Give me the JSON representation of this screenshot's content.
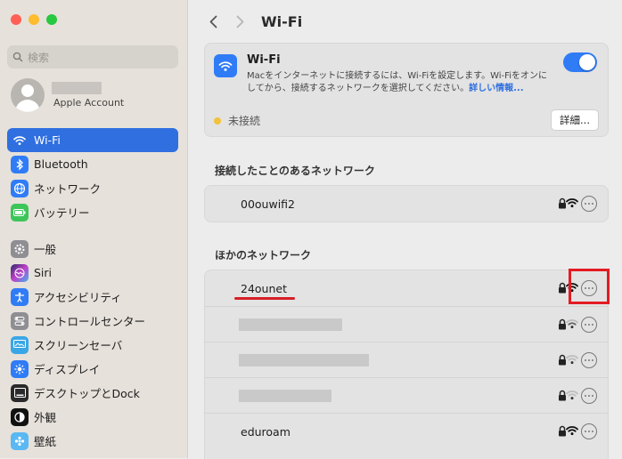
{
  "sidebar": {
    "search_placeholder": "検索",
    "account_label": "Apple Account",
    "items": [
      {
        "label": "Wi-Fi",
        "icon": "wifi-icon"
      },
      {
        "label": "Bluetooth",
        "icon": "bluetooth-icon"
      },
      {
        "label": "ネットワーク",
        "icon": "globe-icon"
      },
      {
        "label": "バッテリー",
        "icon": "battery-icon"
      },
      {
        "label": "一般",
        "icon": "gear-icon"
      },
      {
        "label": "Siri",
        "icon": "siri-icon"
      },
      {
        "label": "アクセシビリティ",
        "icon": "accessibility-icon"
      },
      {
        "label": "コントロールセンター",
        "icon": "control-center-icon"
      },
      {
        "label": "スクリーンセーバ",
        "icon": "screensaver-icon"
      },
      {
        "label": "ディスプレイ",
        "icon": "display-icon"
      },
      {
        "label": "デスクトップとDock",
        "icon": "desktop-dock-icon"
      },
      {
        "label": "外観",
        "icon": "appearance-icon"
      },
      {
        "label": "壁紙",
        "icon": "wallpaper-icon"
      }
    ]
  },
  "header": {
    "title": "Wi-Fi"
  },
  "wifi_card": {
    "title": "Wi-Fi",
    "description": "Macをインターネットに接続するには、Wi-Fiを設定します。Wi-Fiをオンにしてから、接続するネットワークを選択してください。",
    "link": "詳しい情報...",
    "status": "未接続",
    "details_button": "詳細..."
  },
  "known_section": {
    "title": "接続したことのあるネットワーク",
    "networks": [
      {
        "name": "00ouwifi2"
      }
    ]
  },
  "other_section": {
    "title": "ほかのネットワーク",
    "networks": [
      {
        "name": "24ounet"
      },
      {
        "name": ""
      },
      {
        "name": ""
      },
      {
        "name": ""
      },
      {
        "name": "eduroam"
      }
    ]
  },
  "colors": {
    "accent": "#2f7cf6",
    "highlight_red": "#e31b23",
    "status_yellow": "#f2c23a"
  }
}
